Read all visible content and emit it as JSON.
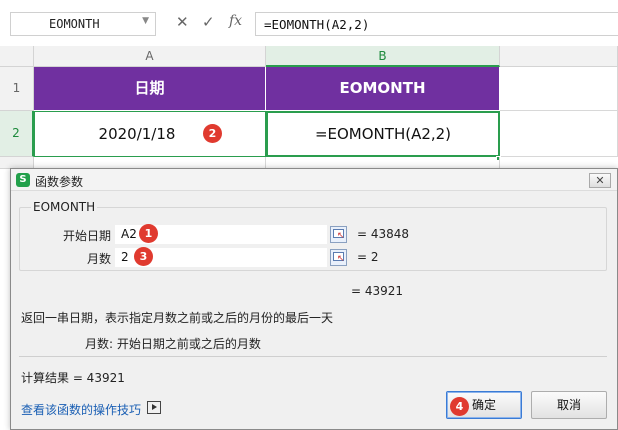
{
  "formula_bar": {
    "name_box": "EOMONTH",
    "cancel_glyph": "✕",
    "confirm_glyph": "✓",
    "fx_label": "fx",
    "formula": "=EOMONTH(A2,2)"
  },
  "sheet": {
    "columns": [
      "A",
      "B"
    ],
    "rows": [
      "1",
      "2"
    ],
    "cells": {
      "A1": "日期",
      "B1": "EOMONTH",
      "A2": "2020/1/18",
      "B2": "=EOMONTH(A2,2)"
    },
    "header_fill": "#7030a0"
  },
  "badges": {
    "b1": "1",
    "b2": "2",
    "b3": "3",
    "b4": "4"
  },
  "dialog": {
    "title": "函数参数",
    "logo": "S",
    "close": "✕",
    "function_name": "EOMONTH",
    "args": [
      {
        "label": "开始日期",
        "value": "A2",
        "result": "= 43848"
      },
      {
        "label": "月数",
        "value": "2",
        "result": "= 2"
      }
    ],
    "formula_result": "= 43921",
    "description": "返回一串日期，表示指定月数之前或之后的月份的最后一天",
    "param_help": "月数:  开始日期之前或之后的月数",
    "calc_result": "计算结果 = 43921",
    "help_link": "查看该函数的操作技巧",
    "ok_label": "确定",
    "cancel_label": "取消"
  }
}
